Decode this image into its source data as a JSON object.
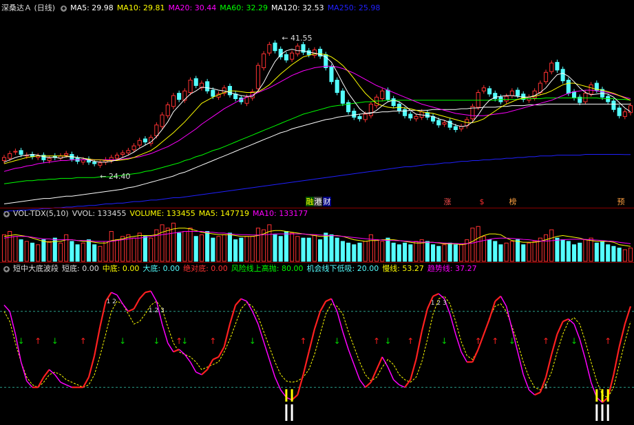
{
  "colors": {
    "up": "#ff3232",
    "down": "#54ffff",
    "ma5": "#ffffff",
    "ma10": "#ffff00",
    "ma20": "#ff00ff",
    "ma60": "#00ff00",
    "ma120": "#ffffff",
    "ma250": "#2020ff"
  },
  "price_panel": {
    "title": "深桑达Ａ (日线)",
    "ma_labels": [
      {
        "text": "MA5: 29.98",
        "color": "#ffffff"
      },
      {
        "text": "MA10: 29.81",
        "color": "#ffff00"
      },
      {
        "text": "MA20: 30.44",
        "color": "#ff00ff"
      },
      {
        "text": "MA60: 32.29",
        "color": "#00ff00"
      },
      {
        "text": "MA120: 32.53",
        "color": "#ffffff"
      },
      {
        "text": "MA250: 25.98",
        "color": "#2020ff"
      }
    ],
    "high_marker": "41.55",
    "low_marker": "24.40",
    "event_tags": [
      {
        "text": "融",
        "color": "#ffff00",
        "bg": "#005000"
      },
      {
        "text": "港",
        "color": "#ffffff",
        "bg": "#404040"
      },
      {
        "text": "财",
        "color": "#ffffff",
        "bg": "#000080"
      },
      {
        "text": "涨",
        "color": "#ff5050",
        "bg": "#000000"
      },
      {
        "text": "$",
        "color": "#ff3030",
        "bg": "#000000"
      },
      {
        "text": "榜",
        "color": "#ffa040",
        "bg": "#000000"
      },
      {
        "text": "预",
        "color": "#ffa040",
        "bg": "#000000"
      }
    ]
  },
  "volume_panel": {
    "labels": [
      {
        "text": "VOL-TDX(5,10)",
        "color": "#dddddd"
      },
      {
        "text": "VVOL: 133455",
        "color": "#dddddd"
      },
      {
        "text": "VOLUME: 133455",
        "color": "#ffff00"
      },
      {
        "text": "MA5: 147719",
        "color": "#ffff00"
      },
      {
        "text": "MA10: 133177",
        "color": "#ff00ff"
      }
    ]
  },
  "indicator_panel": {
    "labels": [
      {
        "text": "短中大底波段",
        "color": "#dddddd"
      },
      {
        "text": "短底: 0.00",
        "color": "#dddddd"
      },
      {
        "text": "中底: 0.00",
        "color": "#ffff00"
      },
      {
        "text": "大底: 0.00",
        "color": "#54ffff"
      },
      {
        "text": "绝对底: 0.00",
        "color": "#ff3232"
      },
      {
        "text": "风险线上高抛: 80.00",
        "color": "#00ff00"
      },
      {
        "text": "机会线下低吸: 20.00",
        "color": "#54ffff"
      },
      {
        "text": "慢线: 53.27",
        "color": "#ffff00"
      },
      {
        "text": "趋势线: 37.27",
        "color": "#ff00ff"
      }
    ],
    "peak_labels": [
      "1 2",
      "1 2 3",
      "1 2 3",
      "1"
    ]
  },
  "chart_data": {
    "type": "line",
    "price_axis_range": [
      20,
      44
    ],
    "candles_close": [
      25.6,
      26.1,
      26.4,
      26.0,
      25.9,
      25.7,
      25.8,
      25.3,
      25.5,
      25.6,
      25.8,
      26.1,
      25.4,
      25.1,
      25.3,
      25.0,
      24.8,
      24.9,
      25.3,
      25.6,
      25.9,
      26.2,
      26.5,
      27.1,
      27.8,
      27.6,
      28.2,
      29.8,
      31.1,
      32.4,
      33.6,
      33.1,
      34.2,
      35.6,
      34.9,
      35.2,
      34.2,
      33.5,
      33.8,
      34.6,
      33.7,
      33.2,
      32.8,
      33.4,
      34.1,
      37.5,
      39.0,
      40.2,
      39.4,
      38.6,
      38.2,
      39.1,
      40.0,
      39.2,
      38.9,
      39.5,
      38.7,
      37.2,
      35.4,
      34.0,
      32.6,
      31.5,
      30.8,
      30.6,
      31.2,
      32.5,
      33.4,
      34.2,
      33.1,
      32.3,
      31.6,
      31.0,
      30.7,
      30.9,
      31.5,
      30.8,
      30.3,
      29.8,
      30.1,
      29.5,
      29.2,
      29.6,
      30.5,
      32.2,
      34.0,
      34.6,
      33.8,
      33.2,
      32.8,
      33.5,
      34.2,
      33.6,
      33.1,
      33.4,
      34.2,
      35.2,
      36.6,
      37.8,
      36.9,
      35.5,
      33.9,
      33.3,
      32.7,
      33.9,
      35.0,
      34.3,
      33.4,
      32.8,
      31.8,
      31.0,
      31.5,
      32.3
    ],
    "candles_open": [
      25.2,
      25.5,
      26.3,
      26.5,
      25.8,
      26.0,
      25.6,
      25.9,
      25.2,
      25.8,
      25.5,
      25.9,
      26.0,
      25.5,
      25.0,
      25.4,
      25.0,
      24.6,
      25.0,
      25.2,
      25.5,
      26.0,
      26.2,
      26.6,
      27.2,
      28.0,
      27.4,
      28.4,
      29.6,
      31.0,
      32.2,
      33.9,
      33.0,
      34.0,
      35.8,
      34.6,
      35.4,
      34.3,
      33.4,
      33.9,
      34.8,
      33.8,
      33.3,
      32.6,
      33.3,
      34.5,
      37.2,
      39.1,
      40.4,
      39.6,
      38.9,
      38.3,
      39.0,
      40.2,
      39.4,
      38.8,
      39.6,
      38.9,
      37.3,
      35.6,
      34.2,
      32.7,
      31.6,
      30.9,
      30.5,
      31.0,
      32.3,
      33.2,
      34.3,
      33.2,
      32.5,
      31.8,
      31.2,
      30.6,
      30.8,
      31.4,
      30.9,
      30.4,
      29.9,
      30.3,
      29.6,
      29.3,
      29.7,
      30.6,
      32.1,
      34.2,
      34.5,
      33.9,
      33.4,
      32.9,
      33.6,
      34.3,
      33.8,
      33.0,
      33.3,
      34.0,
      35.4,
      36.7,
      37.9,
      37.0,
      35.6,
      34.1,
      33.4,
      32.8,
      33.8,
      35.2,
      34.4,
      33.5,
      32.9,
      32.0,
      30.9,
      31.4
    ],
    "ma5": [
      25.0,
      25.3,
      25.6,
      25.8,
      25.9,
      26.0,
      25.9,
      25.7,
      25.6,
      25.6,
      25.5,
      25.7,
      25.7,
      25.6,
      25.5,
      25.3,
      25.1,
      25.0,
      25.0,
      25.1,
      25.3,
      25.6,
      25.9,
      26.3,
      26.8,
      27.2,
      27.6,
      28.3,
      29.2,
      30.2,
      31.5,
      32.3,
      33.1,
      33.8,
      34.2,
      34.7,
      34.6,
      34.5,
      34.3,
      34.2,
      34.0,
      33.8,
      33.6,
      33.5,
      33.5,
      34.2,
      35.3,
      36.7,
      38.0,
      38.9,
      39.4,
      39.6,
      39.4,
      39.4,
      39.2,
      39.1,
      38.9,
      38.6,
      37.9,
      36.6,
      35.2,
      33.9,
      32.9,
      31.9,
      31.3,
      31.3,
      31.7,
      32.3,
      32.8,
      33.0,
      32.8,
      32.3,
      31.7,
      31.2,
      31.1,
      31.0,
      30.9,
      30.6,
      30.4,
      30.1,
      29.8,
      29.6,
      29.7,
      30.2,
      31.1,
      32.2,
      33.0,
      33.4,
      33.5,
      33.6,
      33.6,
      33.5,
      33.4,
      33.4,
      33.6,
      34.0,
      34.6,
      35.5,
      36.3,
      36.5,
      36.1,
      35.4,
      34.6,
      34.0,
      33.7,
      33.8,
      33.9,
      33.8,
      33.4,
      32.7,
      32.0,
      31.5
    ],
    "ma10": [
      24.8,
      25.0,
      25.2,
      25.4,
      25.6,
      25.7,
      25.8,
      25.8,
      25.8,
      25.8,
      25.8,
      25.8,
      25.7,
      25.6,
      25.5,
      25.4,
      25.3,
      25.3,
      25.2,
      25.2,
      25.2,
      25.3,
      25.4,
      25.6,
      25.9,
      26.2,
      26.5,
      27.0,
      27.6,
      28.2,
      28.8,
      29.5,
      30.2,
      31.0,
      31.8,
      32.6,
      33.0,
      33.4,
      33.7,
      34.0,
      34.2,
      34.2,
      34.1,
      34.0,
      34.0,
      34.1,
      34.5,
      35.0,
      35.7,
      36.4,
      37.0,
      37.6,
      38.1,
      38.6,
      38.8,
      39.0,
      39.0,
      38.9,
      38.6,
      38.1,
      37.5,
      36.7,
      35.8,
      34.8,
      33.9,
      33.2,
      32.6,
      32.3,
      32.1,
      32.0,
      32.1,
      32.0,
      31.9,
      31.7,
      31.5,
      31.4,
      31.3,
      31.1,
      30.9,
      30.7,
      30.5,
      30.3,
      30.1,
      30.1,
      30.3,
      30.6,
      31.1,
      31.6,
      32.1,
      32.5,
      32.8,
      33.1,
      33.3,
      33.4,
      33.5,
      33.7,
      33.9,
      34.2,
      34.6,
      35.0,
      35.2,
      35.2,
      35.0,
      34.8,
      34.6,
      34.4,
      34.3,
      34.1,
      33.9,
      33.6,
      33.3,
      33.0
    ],
    "ma20": [
      23.8,
      24.0,
      24.2,
      24.3,
      24.5,
      24.6,
      24.8,
      24.9,
      25.0,
      25.1,
      25.2,
      25.2,
      25.3,
      25.3,
      25.3,
      25.3,
      25.3,
      25.3,
      25.3,
      25.3,
      25.3,
      25.4,
      25.5,
      25.6,
      25.7,
      25.9,
      26.1,
      26.4,
      26.7,
      27.0,
      27.4,
      27.8,
      28.3,
      28.8,
      29.3,
      29.9,
      30.4,
      30.9,
      31.4,
      31.9,
      32.3,
      32.7,
      33.1,
      33.4,
      33.7,
      34.0,
      34.3,
      34.6,
      35.0,
      35.4,
      35.8,
      36.2,
      36.5,
      36.8,
      37.0,
      37.2,
      37.3,
      37.4,
      37.4,
      37.3,
      37.1,
      36.8,
      36.5,
      36.1,
      35.7,
      35.3,
      34.9,
      34.6,
      34.3,
      34.0,
      33.7,
      33.4,
      33.1,
      32.8,
      32.5,
      32.3,
      32.1,
      31.9,
      31.7,
      31.5,
      31.3,
      31.2,
      31.1,
      31.0,
      31.0,
      31.0,
      31.1,
      31.2,
      31.3,
      31.4,
      31.6,
      31.8,
      32.0,
      32.2,
      32.4,
      32.6,
      32.8,
      33.0,
      33.3,
      33.6,
      33.9,
      34.1,
      34.2,
      34.3,
      34.3,
      34.2,
      34.1,
      34.0,
      33.8,
      33.6,
      33.4,
      33.2
    ],
    "ma60": [
      22.2,
      22.3,
      22.4,
      22.5,
      22.6,
      22.6,
      22.7,
      22.7,
      22.8,
      22.8,
      22.9,
      22.9,
      22.9,
      23.0,
      23.0,
      23.0,
      23.0,
      23.1,
      23.1,
      23.1,
      23.2,
      23.3,
      23.4,
      23.5,
      23.6,
      23.8,
      23.9,
      24.1,
      24.3,
      24.5,
      24.7,
      24.9,
      25.2,
      25.4,
      25.7,
      25.9,
      26.2,
      26.5,
      26.7,
      27.0,
      27.3,
      27.6,
      27.9,
      28.2,
      28.5,
      28.8,
      29.1,
      29.4,
      29.7,
      30.0,
      30.3,
      30.6,
      30.9,
      31.2,
      31.4,
      31.6,
      31.8,
      32.0,
      32.2,
      32.3,
      32.4,
      32.5,
      32.6,
      32.7,
      32.8,
      32.8,
      32.9,
      32.9,
      33.0,
      33.0,
      33.0,
      33.0,
      33.0,
      33.0,
      33.0,
      33.0,
      33.0,
      33.0,
      33.0,
      33.0,
      33.0,
      33.0,
      33.0,
      33.0,
      33.0,
      33.0,
      33.0,
      33.0,
      33.1,
      33.1,
      33.1,
      33.1,
      33.2,
      33.2,
      33.2,
      33.2,
      33.3,
      33.3,
      33.3,
      33.3,
      33.3,
      33.3,
      33.3,
      33.3,
      33.3,
      33.3,
      33.2,
      33.2,
      33.2,
      33.1,
      33.1,
      33.0
    ],
    "ma120": [
      19.6,
      19.7,
      19.8,
      19.9,
      20.0,
      20.1,
      20.2,
      20.3,
      20.3,
      20.4,
      20.5,
      20.6,
      20.6,
      20.7,
      20.8,
      20.9,
      21.0,
      21.1,
      21.2,
      21.3,
      21.4,
      21.5,
      21.7,
      21.8,
      22.0,
      22.2,
      22.4,
      22.6,
      22.8,
      23.0,
      23.2,
      23.5,
      23.7,
      24.0,
      24.3,
      24.6,
      24.9,
      25.2,
      25.5,
      25.8,
      26.1,
      26.4,
      26.7,
      27.0,
      27.3,
      27.6,
      27.9,
      28.2,
      28.5,
      28.8,
      29.0,
      29.3,
      29.5,
      29.7,
      29.9,
      30.1,
      30.3,
      30.5,
      30.6,
      30.8,
      30.9,
      31.0,
      31.1,
      31.2,
      31.3,
      31.4,
      31.4,
      31.5,
      31.5,
      31.6,
      31.6,
      31.6,
      31.7,
      31.7,
      31.7,
      31.7,
      31.8,
      31.8,
      31.8,
      31.8,
      31.8,
      31.9,
      31.9,
      32.0,
      32.0,
      32.1,
      32.1,
      32.1,
      32.2,
      32.2,
      32.3,
      32.3,
      32.3,
      32.4,
      32.4,
      32.4,
      32.5,
      32.5,
      32.5,
      32.5,
      32.5,
      32.5,
      32.5,
      32.5,
      32.5,
      32.5,
      32.5,
      32.5,
      32.5,
      32.5,
      32.5,
      32.5
    ],
    "ma250": [
      18.6,
      18.7,
      18.7,
      18.8,
      18.8,
      18.9,
      18.9,
      19.0,
      19.0,
      19.1,
      19.1,
      19.2,
      19.2,
      19.3,
      19.3,
      19.4,
      19.4,
      19.5,
      19.6,
      19.6,
      19.7,
      19.7,
      19.8,
      19.9,
      19.9,
      20.0,
      20.1,
      20.1,
      20.2,
      20.3,
      20.4,
      20.4,
      20.5,
      20.6,
      20.7,
      20.8,
      20.9,
      21.0,
      21.1,
      21.2,
      21.3,
      21.4,
      21.5,
      21.6,
      21.7,
      21.8,
      21.9,
      22.0,
      22.1,
      22.2,
      22.3,
      22.4,
      22.5,
      22.6,
      22.7,
      22.8,
      22.9,
      23.0,
      23.1,
      23.2,
      23.3,
      23.4,
      23.5,
      23.6,
      23.7,
      23.8,
      23.9,
      24.0,
      24.1,
      24.2,
      24.3,
      24.4,
      24.4,
      24.5,
      24.6,
      24.7,
      24.7,
      24.8,
      24.9,
      24.9,
      25.0,
      25.1,
      25.1,
      25.2,
      25.2,
      25.3,
      25.3,
      25.4,
      25.4,
      25.5,
      25.5,
      25.6,
      25.6,
      25.7,
      25.7,
      25.8,
      25.8,
      25.8,
      25.9,
      25.9,
      25.9,
      25.9,
      25.9,
      26.0,
      26.0,
      26.0,
      26.0,
      26.0,
      26.0,
      26.0,
      25.98,
      25.98
    ],
    "volume": [
      1.6,
      1.8,
      1.5,
      1.3,
      1.2,
      1.1,
      1.0,
      1.3,
      1.2,
      1.4,
      1.1,
      1.6,
      1.2,
      1.0,
      1.1,
      1.3,
      1.0,
      0.9,
      1.2,
      1.8,
      1.3,
      1.5,
      1.6,
      1.4,
      1.7,
      1.5,
      1.4,
      1.9,
      2.2,
      2.0,
      2.3,
      1.7,
      1.8,
      2.0,
      1.5,
      1.6,
      1.8,
      1.4,
      1.5,
      1.6,
      1.7,
      1.3,
      1.4,
      1.5,
      1.5,
      2.0,
      1.9,
      2.2,
      1.6,
      1.5,
      1.8,
      1.7,
      1.5,
      1.4,
      1.4,
      1.6,
      1.3,
      1.7,
      1.6,
      1.4,
      1.2,
      1.1,
      1.0,
      1.1,
      1.2,
      1.6,
      1.3,
      1.2,
      1.4,
      1.1,
      1.0,
      1.1,
      1.0,
      1.2,
      1.3,
      1.2,
      1.0,
      0.9,
      1.0,
      1.1,
      1.0,
      1.0,
      1.3,
      2.0,
      2.1,
      1.5,
      1.3,
      1.2,
      1.0,
      1.1,
      1.2,
      1.3,
      1.0,
      1.1,
      1.2,
      1.4,
      1.6,
      1.9,
      1.4,
      1.3,
      1.2,
      1.0,
      1.1,
      1.3,
      1.4,
      1.1,
      1.2,
      1.0,
      0.9,
      0.8,
      0.7,
      0.8
    ],
    "vol_ma5": [
      1.5,
      1.55,
      1.6,
      1.55,
      1.5,
      1.4,
      1.3,
      1.2,
      1.15,
      1.2,
      1.2,
      1.3,
      1.3,
      1.25,
      1.2,
      1.2,
      1.15,
      1.1,
      1.1,
      1.25,
      1.3,
      1.35,
      1.45,
      1.5,
      1.55,
      1.55,
      1.55,
      1.6,
      1.75,
      1.85,
      1.95,
      2.0,
      2.0,
      1.95,
      1.85,
      1.75,
      1.7,
      1.65,
      1.6,
      1.6,
      1.6,
      1.55,
      1.5,
      1.5,
      1.5,
      1.55,
      1.65,
      1.8,
      1.85,
      1.85,
      1.8,
      1.75,
      1.7,
      1.65,
      1.6,
      1.55,
      1.5,
      1.5,
      1.55,
      1.55,
      1.5,
      1.4,
      1.3,
      1.25,
      1.2,
      1.25,
      1.25,
      1.3,
      1.3,
      1.3,
      1.25,
      1.2,
      1.15,
      1.1,
      1.1,
      1.15,
      1.15,
      1.1,
      1.05,
      1.05,
      1.05,
      1.0,
      1.05,
      1.2,
      1.4,
      1.55,
      1.65,
      1.65,
      1.6,
      1.4,
      1.25,
      1.2,
      1.15,
      1.15,
      1.15,
      1.2,
      1.3,
      1.4,
      1.5,
      1.55,
      1.5,
      1.45,
      1.4,
      1.3,
      1.25,
      1.2,
      1.2,
      1.2,
      1.15,
      1.0,
      0.95,
      0.9
    ],
    "vol_ma10": [
      1.4,
      1.45,
      1.5,
      1.5,
      1.5,
      1.45,
      1.4,
      1.35,
      1.35,
      1.3,
      1.3,
      1.3,
      1.3,
      1.25,
      1.25,
      1.25,
      1.2,
      1.2,
      1.2,
      1.2,
      1.25,
      1.3,
      1.35,
      1.4,
      1.4,
      1.45,
      1.5,
      1.55,
      1.6,
      1.65,
      1.7,
      1.75,
      1.8,
      1.8,
      1.8,
      1.8,
      1.75,
      1.75,
      1.7,
      1.7,
      1.65,
      1.62,
      1.6,
      1.6,
      1.58,
      1.58,
      1.6,
      1.62,
      1.65,
      1.65,
      1.65,
      1.65,
      1.65,
      1.65,
      1.62,
      1.6,
      1.58,
      1.56,
      1.55,
      1.53,
      1.5,
      1.47,
      1.43,
      1.4,
      1.36,
      1.33,
      1.3,
      1.28,
      1.26,
      1.25,
      1.24,
      1.22,
      1.2,
      1.18,
      1.16,
      1.15,
      1.14,
      1.12,
      1.1,
      1.08,
      1.07,
      1.06,
      1.07,
      1.1,
      1.18,
      1.25,
      1.32,
      1.38,
      1.4,
      1.4,
      1.38,
      1.35,
      1.32,
      1.3,
      1.25,
      1.22,
      1.22,
      1.24,
      1.27,
      1.3,
      1.32,
      1.33,
      1.33,
      1.32,
      1.3,
      1.28,
      1.25,
      1.22,
      1.2,
      1.15,
      1.1,
      1.06
    ],
    "slow_line": [
      80,
      72,
      55,
      40,
      28,
      22,
      20,
      24,
      30,
      32,
      30,
      26,
      24,
      22,
      20,
      22,
      30,
      45,
      62,
      80,
      88,
      86,
      78,
      70,
      72,
      78,
      85,
      88,
      82,
      68,
      55,
      48,
      46,
      44,
      40,
      34,
      36,
      38,
      40,
      48,
      58,
      70,
      82,
      87,
      84,
      76,
      64,
      52,
      40,
      30,
      25,
      24,
      25,
      28,
      34,
      46,
      62,
      78,
      86,
      84,
      78,
      64,
      52,
      40,
      30,
      25,
      28,
      36,
      42,
      38,
      30,
      26,
      24,
      28,
      40,
      58,
      78,
      90,
      92,
      86,
      72,
      56,
      45,
      42,
      50,
      62,
      75,
      84,
      86,
      80,
      68,
      55,
      40,
      28,
      20,
      18,
      22,
      32,
      48,
      62,
      72,
      75,
      70,
      56,
      40,
      25,
      14,
      12,
      20,
      38,
      56,
      72
    ],
    "trend_line": [
      85,
      80,
      62,
      40,
      25,
      20,
      20,
      28,
      34,
      30,
      24,
      22,
      20,
      20,
      20,
      28,
      45,
      68,
      88,
      95,
      93,
      86,
      80,
      82,
      90,
      95,
      96,
      88,
      70,
      55,
      48,
      50,
      46,
      40,
      32,
      30,
      34,
      42,
      44,
      52,
      70,
      85,
      90,
      88,
      80,
      70,
      56,
      42,
      28,
      18,
      12,
      10,
      14,
      30,
      48,
      66,
      80,
      88,
      90,
      80,
      64,
      50,
      38,
      26,
      20,
      24,
      34,
      44,
      36,
      26,
      22,
      20,
      26,
      42,
      64,
      82,
      92,
      94,
      90,
      78,
      62,
      48,
      40,
      40,
      50,
      62,
      74,
      88,
      92,
      84,
      66,
      48,
      30,
      18,
      14,
      16,
      28,
      46,
      62,
      72,
      74,
      70,
      58,
      42,
      24,
      12,
      8,
      12,
      30,
      52,
      70,
      84
    ],
    "risk_level": 80,
    "chance_level": 20
  }
}
